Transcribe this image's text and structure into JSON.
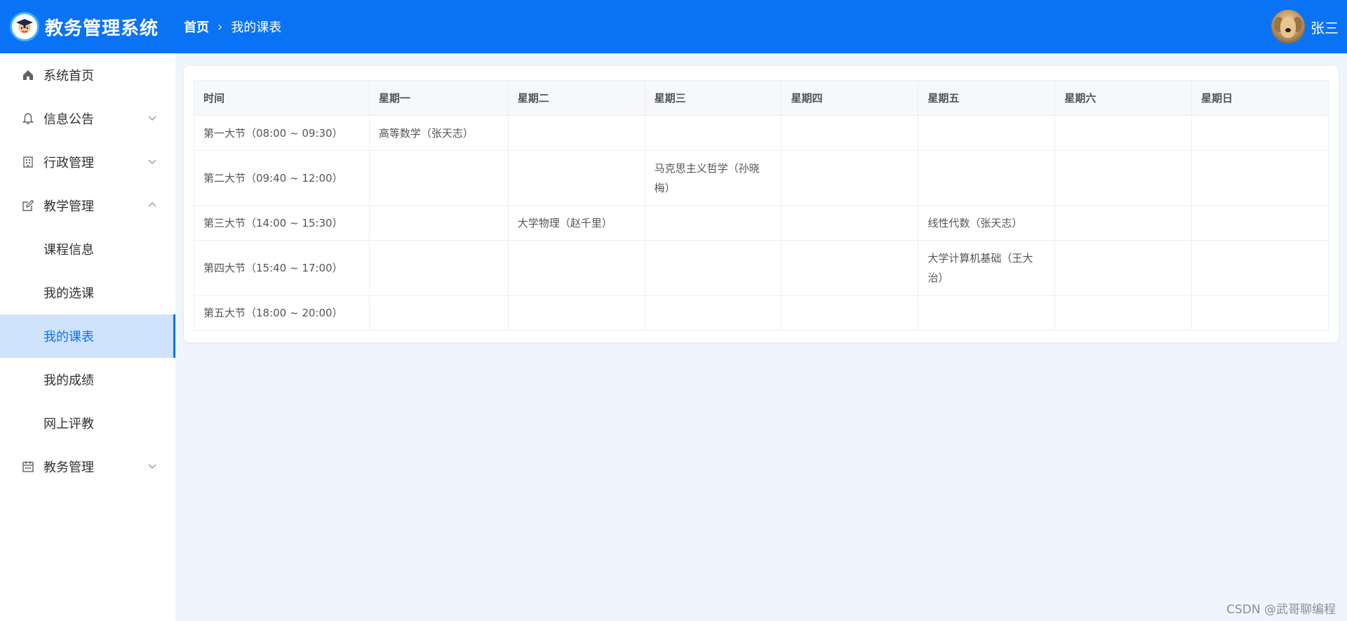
{
  "header": {
    "app_title": "教务管理系统",
    "breadcrumb": {
      "home": "首页",
      "separator": "›",
      "current": "我的课表"
    },
    "user_name": "张三"
  },
  "sidebar": {
    "items": [
      {
        "label": "系统首页",
        "icon": "home-icon"
      },
      {
        "label": "信息公告",
        "icon": "bell-icon"
      },
      {
        "label": "行政管理",
        "icon": "building-icon"
      },
      {
        "label": "教学管理",
        "icon": "edit-icon",
        "expanded": true,
        "children": [
          "课程信息",
          "我的选课",
          "我的课表",
          "我的成绩",
          "网上评教"
        ]
      },
      {
        "label": "教务管理",
        "icon": "calendar-icon"
      }
    ],
    "active": "我的课表"
  },
  "schedule": {
    "headers": [
      "时间",
      "星期一",
      "星期二",
      "星期三",
      "星期四",
      "星期五",
      "星期六",
      "星期日"
    ],
    "rows": [
      [
        "第一大节（08:00 ~ 09:30）",
        "高等数学（张天志）",
        "",
        "",
        "",
        "",
        "",
        ""
      ],
      [
        "第二大节（09:40 ~ 12:00）",
        "",
        "",
        "马克思主义哲学（孙晓梅）",
        "",
        "",
        "",
        ""
      ],
      [
        "第三大节（14:00 ~ 15:30）",
        "",
        "大学物理（赵千里）",
        "",
        "",
        "线性代数（张天志）",
        "",
        ""
      ],
      [
        "第四大节（15:40 ~ 17:00）",
        "",
        "",
        "",
        "",
        "大学计算机基础（王大治）",
        "",
        ""
      ],
      [
        "第五大节（18:00 ~ 20:00）",
        "",
        "",
        "",
        "",
        "",
        "",
        ""
      ]
    ]
  },
  "watermark": "CSDN @武哥聊编程",
  "colors": {
    "primary": "#0a73f5",
    "active_bg": "#cfe3fc",
    "page_bg": "#f0f4fc"
  }
}
